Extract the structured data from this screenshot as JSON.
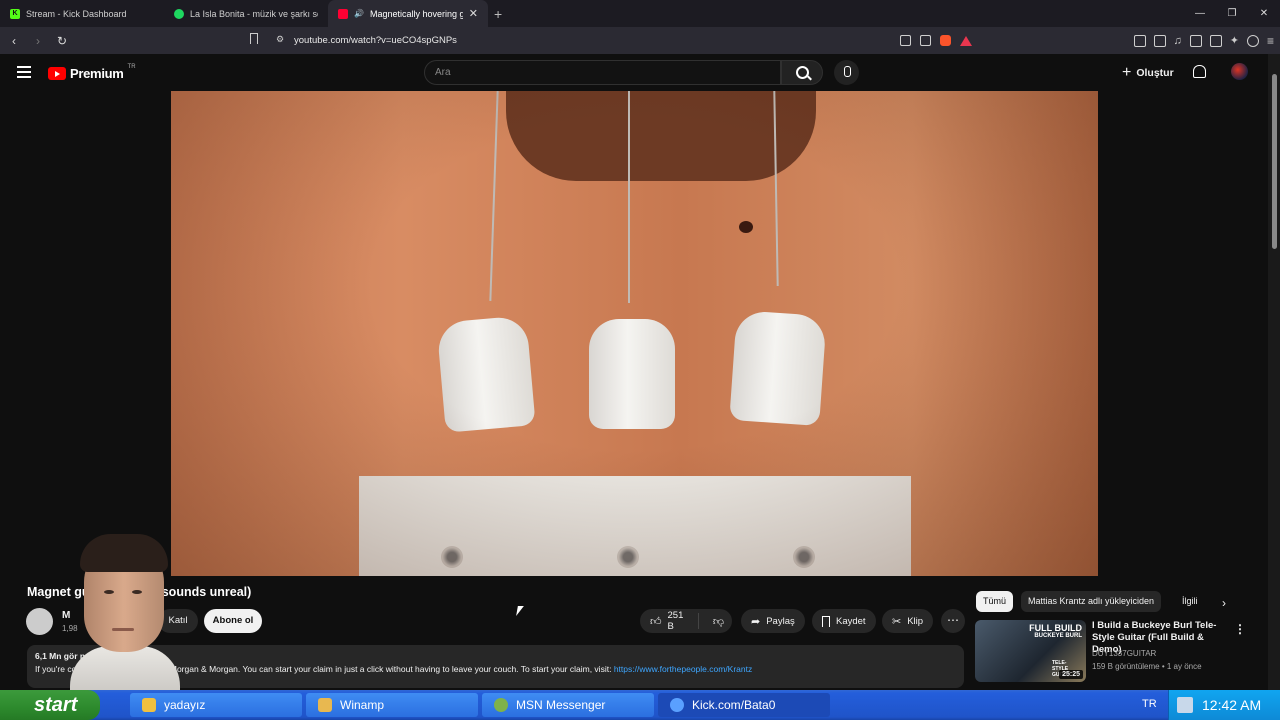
{
  "browser": {
    "tabs": [
      {
        "label": "Stream - Kick Dashboard",
        "favicon_color": "#53fc18",
        "favicon_glyph": "K"
      },
      {
        "label": "La Isla Bonita - müzik ve şarkı sözleri",
        "favicon_color": "#1ed760",
        "favicon_glyph": ""
      },
      {
        "label": "Magnetically hovering guitar",
        "favicon_color": "#ff0033",
        "favicon_glyph": ""
      }
    ],
    "url": "youtube.com/watch?v=ueCO4spGNPs"
  },
  "youtube": {
    "logo_word": "Premium",
    "logo_region": "TR",
    "search_placeholder": "Ara",
    "create_label": "Oluştur"
  },
  "video": {
    "title": "Magnet              guitar strings (sounds unreal)",
    "channel_initial": "M",
    "subs": "1,98",
    "join_label": "Katıl",
    "subscribe_label": "Abone ol",
    "like_count": "251 B",
    "share_label": "Paylaş",
    "save_label": "Kaydet",
    "clip_label": "Klip",
    "views_meta": "6,1 Mn gör                          nce",
    "description": "If you're                         ccident, you can check out Morgan & Morgan. You can start your claim in just a click without having to leave your couch. To start your claim, visit:",
    "description_link": "https://www.forthepeople.com/Krantz"
  },
  "rail": {
    "chips": [
      "Tümü",
      "Mattias Krantz adlı yükleyiciden",
      "İlgili"
    ],
    "items": [
      {
        "thumb_line1": "FULL BUILD",
        "thumb_line2": "BUCKEYE BURL",
        "thumb_line3": "TELE-STYLE GUITAR",
        "duration": "25:25",
        "title": "I Build a Buckeye Burl Tele-Style Guitar (Full Build & Demo)",
        "channel": "DUY1337GUITAR",
        "meta": "159 B görüntüleme • 1 ay önce"
      }
    ]
  },
  "taskbar": {
    "start_label": "start",
    "items": [
      {
        "label": "yadayız",
        "icon_color": "#f0c040"
      },
      {
        "label": "Winamp",
        "icon_color": "#e8b850"
      },
      {
        "label": "MSN Messenger",
        "icon_color": "#7fb24a"
      },
      {
        "label": "Kick.com/Bata0",
        "icon_color": "#5aa0ff"
      }
    ],
    "lang": "TR",
    "clock": "12:42 AM"
  }
}
